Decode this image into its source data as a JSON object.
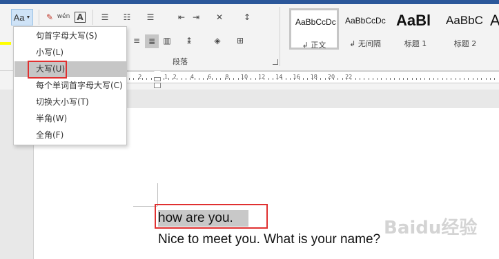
{
  "ribbon": {
    "case_button": {
      "label": "Aa",
      "icon": "change-case-icon"
    },
    "row1_icons": [
      "clear-formatting-icon",
      "phonetic-guide-icon",
      "character-border-icon",
      "bullets-icon",
      "numbering-icon",
      "multilevel-list-icon",
      "decrease-indent-icon",
      "increase-indent-icon",
      "chinese-layout-icon",
      "sort-icon"
    ],
    "row2_icons": [
      "align-right-icon",
      "justify-icon",
      "distributed-icon",
      "line-spacing-icon",
      "shading-icon",
      "borders-icon"
    ],
    "phonetic_label": "wén",
    "char_border_label": "A",
    "paragraph_group_label": "段落",
    "styles": [
      {
        "sample": "AaBbCcDc",
        "name": "↲ 正文"
      },
      {
        "sample": "AaBbCcDc",
        "name": "↲ 无间隔"
      },
      {
        "sample": "AaBl",
        "name": "标题 1"
      },
      {
        "sample": "AaBbC",
        "name": "标题 2"
      },
      {
        "sample": "A",
        "name": ""
      }
    ]
  },
  "ruler": {
    "numbers": [
      "2",
      "1",
      "2",
      "4",
      "6",
      "8",
      "10",
      "12",
      "14",
      "16",
      "18",
      "20",
      "22"
    ]
  },
  "case_menu": {
    "items": [
      {
        "label": "句首字母大写(S)"
      },
      {
        "label": "小写(L)"
      },
      {
        "label": "大写(U)"
      },
      {
        "label": "每个单词首字母大写(C)"
      },
      {
        "label": "切换大小写(T)"
      },
      {
        "label": "半角(W)"
      },
      {
        "label": "全角(F)"
      }
    ]
  },
  "document": {
    "line1": "how are you.",
    "line2": "Nice to meet you. What is your name?"
  },
  "watermark": {
    "text": "Baidu经验"
  },
  "colors": {
    "accent": "#2b579a",
    "highlight_box": "#e03030",
    "selection": "#c8c8c8"
  }
}
